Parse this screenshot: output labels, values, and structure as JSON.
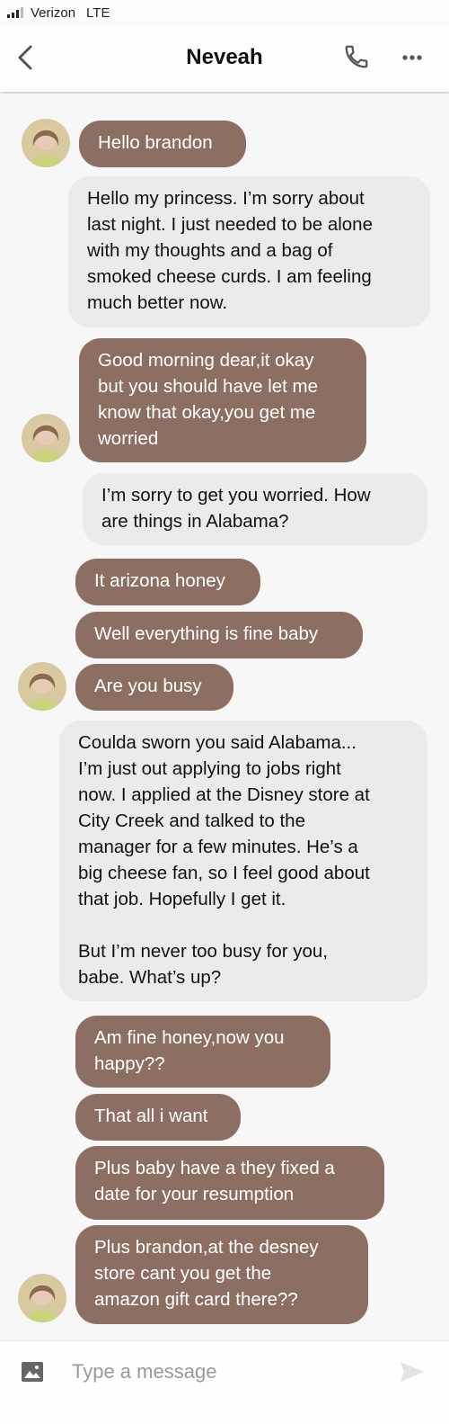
{
  "status_bar": {
    "carrier": "Verizon",
    "network": "LTE"
  },
  "header": {
    "title": "Neveah"
  },
  "messages": [
    {
      "text": "Hello brandon"
    },
    {
      "text": "Hello my princess. I’m sorry about\nlast night. I just needed to be alone\nwith my thoughts and a bag of\nsmoked cheese curds. I am feeling\nmuch better now."
    },
    {
      "text": "Good morning dear,it okay\nbut you should have let me\nknow that okay,you get me\nworried"
    },
    {
      "text": "I’m sorry to get you worried. How\nare things in Alabama?"
    },
    {
      "text": "It arizona honey"
    },
    {
      "text": "Well everything is fine baby"
    },
    {
      "text": "Are you busy"
    },
    {
      "text": "Coulda sworn you said Alabama...\nI’m just out applying to jobs right\nnow. I applied at the Disney store at\nCity Creek and talked to the\nmanager for a few minutes. He’s a\nbig cheese fan, so I feel good about\nthat job. Hopefully I get it.\n\nBut I’m never too busy for you,\nbabe. What’s up?"
    },
    {
      "text": "Am fine honey,now you\nhappy??"
    },
    {
      "text": "That all i want"
    },
    {
      "text": "Plus baby have a they fixed a\ndate for your resumption"
    },
    {
      "text": "Plus brandon,at the desney\nstore cant you get the\namazon gift card there??"
    }
  ],
  "composer": {
    "placeholder": "Type a message"
  },
  "icons": {
    "back": "chevron-left-icon",
    "call": "phone-icon",
    "more": "more-horizontal-icon",
    "image": "image-icon",
    "send": "send-icon"
  },
  "colors": {
    "incoming_bubble": "#8d6e63",
    "outgoing_bubble": "#ebebeb",
    "background": "#f7f7f7"
  }
}
